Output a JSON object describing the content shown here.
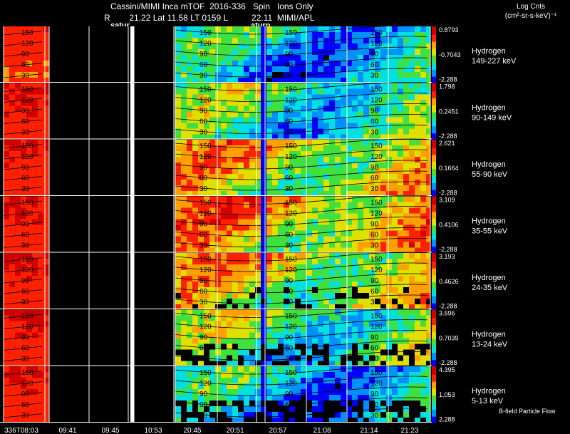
{
  "header": {
    "title": "Cassini/MIMI Inca mTOF  2016-336   Spin   Ions Only",
    "info": "R        21.22 Lat 11.58 LT 0159 L          22.11  MIMI/APL",
    "saturn_label_1": "satur",
    "saturn_label_2": "aturn"
  },
  "legend_title": {
    "line1": "Log Cnts",
    "line2": "(cm²-sr-s-keV)⁻¹"
  },
  "footer_note": "B-field Particle Flow",
  "chart_data": {
    "type": "heatmap",
    "title": "Cassini/MIMI Inca mTOF  2016-336   Spin   Ions Only",
    "time_ticks": [
      "336T08:03",
      "09:41",
      "09:45",
      "10:53",
      "20:45",
      "20:51",
      "20:57",
      "21:08",
      "21:14",
      "21:23"
    ],
    "contour_labels": [
      "150",
      "120",
      "90",
      "60",
      "30"
    ],
    "colorscale": [
      "#0000ff",
      "#0090ff",
      "#00e0e0",
      "#40e040",
      "#e0e000",
      "#ffa000",
      "#ff2000",
      "#d00000"
    ],
    "channels": [
      {
        "species": "Hydrogen",
        "energy": "149-227 keV",
        "max": "0.8793",
        "mid": "-0.7043",
        "min": "-2.288",
        "level": 0.32
      },
      {
        "species": "Hydrogen",
        "energy": "90-149 keV",
        "max": "1.798",
        "mid": "0.2451",
        "min": "-2.288",
        "level": 0.42
      },
      {
        "species": "Hydrogen",
        "energy": "55-90 keV",
        "max": "2.621",
        "mid": "0.1664",
        "min": "-2.288",
        "level": 0.62
      },
      {
        "species": "Hydrogen",
        "energy": "35-55 keV",
        "max": "3.109",
        "mid": "0.4106",
        "min": "-2.288",
        "level": 0.68
      },
      {
        "species": "Hydrogen",
        "energy": "24-35 keV",
        "max": "3.193",
        "mid": "0.4626",
        "min": "-2.288",
        "level": 0.6
      },
      {
        "species": "Hydrogen",
        "energy": "13-24 keV",
        "max": "3.696",
        "mid": "0.7039",
        "min": "-2.288",
        "level": 0.45
      },
      {
        "species": "Hydrogen",
        "energy": "5-13 keV",
        "max": "4.395",
        "mid": "1.053",
        "min": "2.288",
        "level": 0.3
      }
    ]
  }
}
